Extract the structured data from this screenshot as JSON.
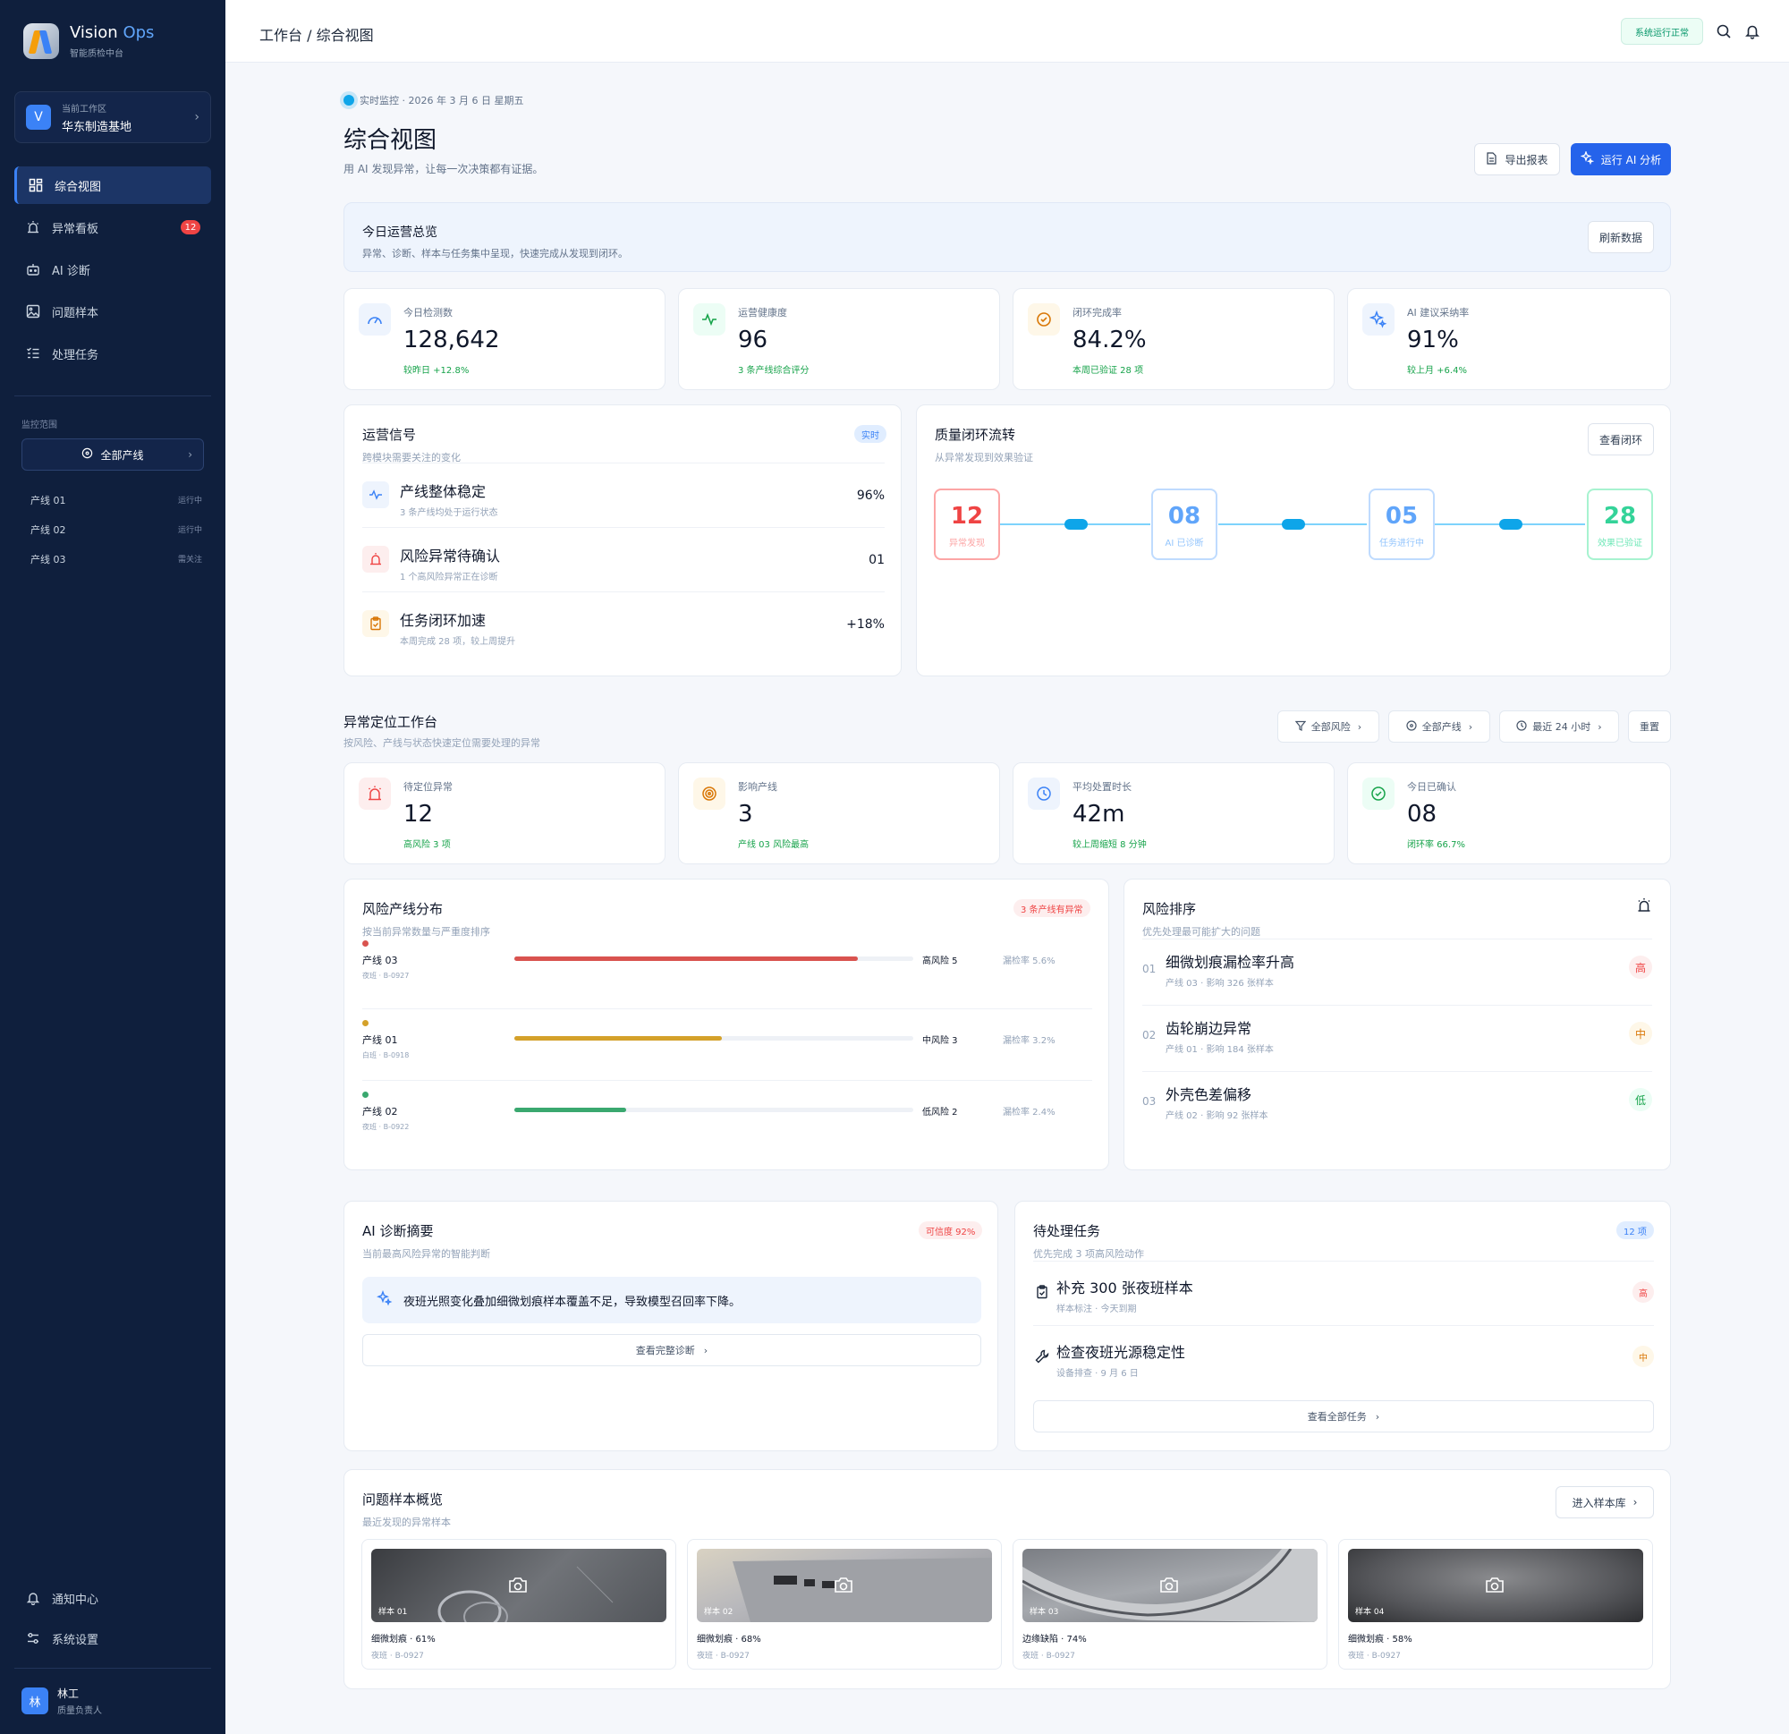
{
  "brand": {
    "name_a": "Vision",
    "name_b": " Ops",
    "sub": "智能质检中台"
  },
  "workspace": {
    "avatar": "V",
    "label": "当前工作区",
    "name": "华东制造基地"
  },
  "nav": [
    {
      "label": "综合视图",
      "icon": "grid-icon",
      "active": true
    },
    {
      "label": "异常看板",
      "icon": "alarm-icon",
      "badge": "12"
    },
    {
      "label": "AI 诊断",
      "icon": "robot-icon"
    },
    {
      "label": "问题样本",
      "icon": "image-icon"
    },
    {
      "label": "处理任务",
      "icon": "checklist-icon"
    }
  ],
  "scope": {
    "title": "监控范围",
    "select": "全部产线",
    "lines": [
      {
        "name": "产线 01",
        "status": "运行中"
      },
      {
        "name": "产线 02",
        "status": "运行中"
      },
      {
        "name": "产线 03",
        "status": "需关注"
      }
    ]
  },
  "bottom_nav": [
    {
      "label": "通知中心",
      "icon": "bell-icon"
    },
    {
      "label": "系统设置",
      "icon": "sliders-icon"
    }
  ],
  "user": {
    "avatar": "林",
    "name": "林工",
    "role": "质量负责人"
  },
  "topbar": {
    "breadcrumb": "工作台 / 综合视图",
    "status": "系统运行正常"
  },
  "header": {
    "live": "实时监控 · 2026 年 3 月 6 日 星期五",
    "title": "综合视图",
    "subtitle": "用 AI 发现异常，让每一次决策都有证据。",
    "export_label": "导出报表",
    "run_label": "运行 AI 分析"
  },
  "overview": {
    "title": "今日运营总览",
    "subtitle": "异常、诊断、样本与任务集中呈现，快速完成从发现到闭环。",
    "refresh_label": "刷新数据"
  },
  "kpis": [
    {
      "label": "今日检测数",
      "value": "128,642",
      "note": "较昨日 +12.8%",
      "icon": "gauge-icon",
      "color": "#3b82f6",
      "bg": "#eef4fd"
    },
    {
      "label": "运营健康度",
      "value": "96",
      "note": "3 条产线综合评分",
      "icon": "pulse-icon",
      "color": "#16a34a",
      "bg": "#ecfdf5"
    },
    {
      "label": "闭环完成率",
      "value": "84.2%",
      "note": "本周已验证 28 项",
      "icon": "check-circle-icon",
      "color": "#d97706",
      "bg": "#fef7e8"
    },
    {
      "label": "AI 建议采纳率",
      "value": "91%",
      "note": "较上月 +6.4%",
      "icon": "sparkle-icon",
      "color": "#3b82f6",
      "bg": "#eef4fd"
    }
  ],
  "signals": {
    "title": "运营信号",
    "subtitle": "跨模块需要关注的变化",
    "badge": "实时",
    "rows": [
      {
        "title": "产线整体稳定",
        "sub": "3 条产线均处于运行状态",
        "value": "96%",
        "icon": "pulse-icon",
        "color": "#3b82f6",
        "bg": "#eef4fd"
      },
      {
        "title": "风险异常待确认",
        "sub": "1 个高风险异常正在诊断",
        "value": "01",
        "icon": "alarm-icon",
        "color": "#ef4444",
        "bg": "#fdeeee"
      },
      {
        "title": "任务闭环加速",
        "sub": "本周完成 28 项，较上周提升",
        "value": "+18%",
        "icon": "clipboard-icon",
        "color": "#d97706",
        "bg": "#fef7e8"
      }
    ]
  },
  "loop": {
    "title": "质量闭环流转",
    "subtitle": "从异常发现到效果验证",
    "button": "查看闭环",
    "nodes": [
      {
        "num": "12",
        "label": "异常发现",
        "color": "#ef4444",
        "border": "#fca5a5"
      },
      {
        "num": "08",
        "label": "AI 已诊断",
        "color": "#60a5fa",
        "border": "#bfdbfe"
      },
      {
        "num": "05",
        "label": "任务进行中",
        "color": "#60a5fa",
        "border": "#bfdbfe"
      },
      {
        "num": "28",
        "label": "效果已验证",
        "color": "#34d399",
        "border": "#a7f3d0"
      }
    ]
  },
  "locate": {
    "title": "异常定位工作台",
    "subtitle": "按风险、产线与状态快速定位需要处理的异常",
    "filters": [
      {
        "label": "全部风险",
        "icon": "filter-icon"
      },
      {
        "label": "全部产线",
        "icon": "target-icon"
      },
      {
        "label": "最近 24 小时",
        "icon": "clock-icon"
      }
    ],
    "reset_label": "重置"
  },
  "kpis2": [
    {
      "label": "待定位异常",
      "value": "12",
      "note": "高风险 3 项",
      "icon": "alarm-icon",
      "color": "#ef4444",
      "bg": "#fdeeee"
    },
    {
      "label": "影响产线",
      "value": "3",
      "note": "产线 03 风险最高",
      "icon": "target-icon",
      "color": "#d97706",
      "bg": "#fef7e8"
    },
    {
      "label": "平均处置时长",
      "value": "42m",
      "note": "较上周缩短 8 分钟",
      "icon": "clock-icon",
      "color": "#3b82f6",
      "bg": "#eef4fd"
    },
    {
      "label": "今日已确认",
      "value": "08",
      "note": "闭环率 66.7%",
      "icon": "check-circle-icon",
      "color": "#16a34a",
      "bg": "#ecfdf5"
    }
  ],
  "risk_dist": {
    "title": "风险产线分布",
    "subtitle": "按当前异常数量与严重度排序",
    "badge": "3 条产线有异常",
    "rows": [
      {
        "name": "产线 03",
        "meta": "夜班 · B-0927",
        "level": "高风险 5",
        "rate": "漏检率 5.6%",
        "fill": 0.86,
        "color": "#d9534f"
      },
      {
        "name": "产线 01",
        "meta": "白班 · B-0918",
        "level": "中风险 3",
        "rate": "漏检率 3.2%",
        "fill": 0.52,
        "color": "#d4a12a"
      },
      {
        "name": "产线 02",
        "meta": "夜班 · B-0922",
        "level": "低风险 2",
        "rate": "漏检率 2.4%",
        "fill": 0.28,
        "color": "#3aa86f"
      }
    ]
  },
  "risk_rank": {
    "title": "风险排序",
    "subtitle": "优先处理最可能扩大的问题",
    "rows": [
      {
        "no": "01",
        "title": "细微划痕漏检率升高",
        "sub": "产线 03 · 影响 326 张样本",
        "badge": "高",
        "color": "#ef4444",
        "bg": "#fdeeee"
      },
      {
        "no": "02",
        "title": "齿轮崩边异常",
        "sub": "产线 01 · 影响 184 张样本",
        "badge": "中",
        "color": "#d97706",
        "bg": "#fef7e8"
      },
      {
        "no": "03",
        "title": "外壳色差偏移",
        "sub": "产线 02 · 影响 92 张样本",
        "badge": "低",
        "color": "#16a34a",
        "bg": "#ecfdf5"
      }
    ]
  },
  "ai_summary": {
    "title": "AI 诊断摘要",
    "subtitle": "当前最高风险异常的智能判断",
    "badge": "可信度 92%",
    "text": "夜班光照变化叠加细微划痕样本覆盖不足，导致模型召回率下降。",
    "button": "查看完整诊断"
  },
  "tasks": {
    "title": "待处理任务",
    "subtitle": "优先完成 3 项高风险动作",
    "badge": "12 项",
    "rows": [
      {
        "title": "补充 300 张夜班样本",
        "sub": "样本标注 · 今天到期",
        "badge": "高",
        "icon": "clipboard-icon",
        "color": "#ef4444",
        "bg": "#fdeeee"
      },
      {
        "title": "检查夜班光源稳定性",
        "sub": "设备排查 · 9 月 6 日",
        "badge": "中",
        "icon": "wrench-icon",
        "color": "#d97706",
        "bg": "#fef7e8"
      }
    ],
    "button": "查看全部任务"
  },
  "samples": {
    "title": "问题样本概览",
    "subtitle": "最近发现的异常样本",
    "button": "进入样本库",
    "items": [
      {
        "tag": "样本 01",
        "name": "细微划痕 · 61%",
        "meta": "夜班 · B-0927"
      },
      {
        "tag": "样本 02",
        "name": "细微划痕 · 68%",
        "meta": "夜班 · B-0927"
      },
      {
        "tag": "样本 03",
        "name": "边缘缺陷 · 74%",
        "meta": "夜班 · B-0927"
      },
      {
        "tag": "样本 04",
        "name": "细微划痕 · 58%",
        "meta": "夜班 · B-0927"
      }
    ]
  }
}
